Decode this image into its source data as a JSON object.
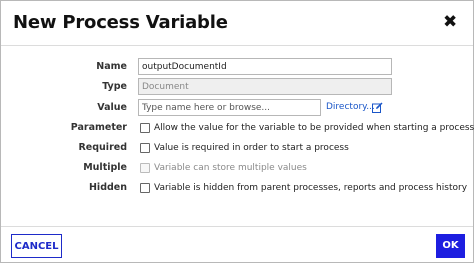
{
  "dialog": {
    "title": "New Process Variable",
    "close_glyph": "✖"
  },
  "form": {
    "name": {
      "label": "Name",
      "value": "outputDocumentId"
    },
    "type": {
      "label": "Type",
      "value": "Document"
    },
    "value": {
      "label": "Value",
      "placeholder": "Type name here or browse...",
      "directory_link": "Directory...",
      "edit_icon": "edit-icon"
    },
    "parameter": {
      "label": "Parameter",
      "text": "Allow the value for the variable to be provided when starting a process",
      "checked": false,
      "disabled": false
    },
    "required": {
      "label": "Required",
      "text": "Value is required in order to start a process",
      "checked": false,
      "disabled": false
    },
    "multiple": {
      "label": "Multiple",
      "text": "Variable can store multiple values",
      "checked": false,
      "disabled": true
    },
    "hidden": {
      "label": "Hidden",
      "text": "Variable is hidden from parent processes, reports and process history",
      "checked": false,
      "disabled": false
    }
  },
  "footer": {
    "cancel_label": "CANCEL",
    "ok_label": "OK"
  },
  "colors": {
    "accent": "#1d1ee0",
    "link": "#1a56c8"
  }
}
